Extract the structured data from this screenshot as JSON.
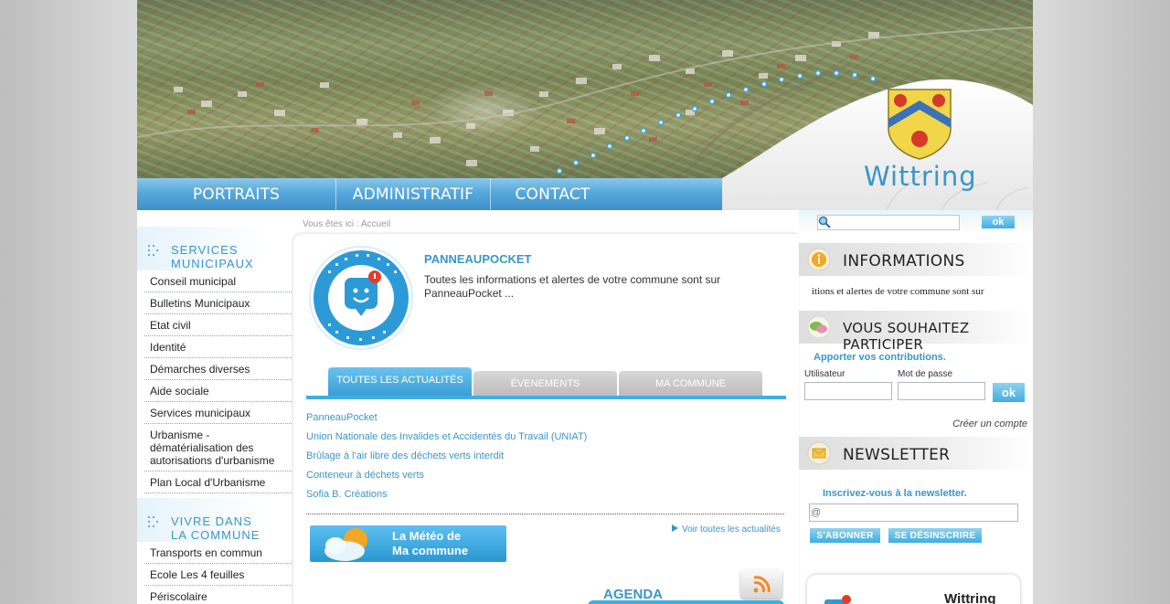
{
  "header": {
    "town_name": "Wittring",
    "nav": [
      "PORTRAITS",
      "ADMINISTRATIF",
      "CONTACT"
    ]
  },
  "breadcrumb": "Vous êtes ici : Accueil",
  "search": {
    "placeholder": "",
    "button": "ok"
  },
  "left": {
    "sections": [
      {
        "title": "SERVICES\nMUNICIPAUX",
        "items": [
          "Conseil municipal",
          "Bulletins Municipaux",
          "Etat civil",
          "Identité",
          "Démarches diverses",
          "Aide sociale",
          "Services municipaux",
          "Urbanisme - dématérialisation des autorisations d'urbanisme",
          "Plan Local d'Urbanisme"
        ]
      },
      {
        "title": "VIVRE DANS\nLA COMMUNE",
        "items": [
          "Transports en commun",
          "Ecole Les 4 feuilles",
          "Périscolaire"
        ]
      }
    ]
  },
  "main": {
    "pp_title": "PANNEAUPOCKET",
    "pp_text": "Toutes les informations et alertes de votre commune sont sur PanneauPocket ...",
    "tabs": [
      "TOUTES LES ACTUALITÉS",
      "ÉVENEMENTS",
      "MA COMMUNE"
    ],
    "news": [
      "PanneauPocket",
      "Union Nationale des Invalides et Accidentés du Travail (UNIAT)",
      "Brûlage à l'air libre des déchets verts interdit",
      "Conteneur à déchets verts",
      "Sofia B. Créations"
    ],
    "meteo": "La Météo de\nMa commune",
    "all_news": "Voir toutes les actualités",
    "agenda": "AGENDA"
  },
  "right": {
    "informations_title": "INFORMATIONS",
    "informations_marquee": "itions et alertes de votre commune sont sur",
    "participer_title": "VOUS SOUHAITEZ PARTICIPER",
    "participer_text": "Apporter vos contributions.",
    "username_label": "Utilisateur",
    "password_label": "Mot de passe",
    "login_button": "ok",
    "create_account": "Créer un compte",
    "newsletter_title": "NEWSLETTER",
    "newsletter_text": "Inscrivez-vous à la newsletter.",
    "newsletter_placeholder": "@",
    "subscribe": "S'ABONNER",
    "unsubscribe": "SE DÉSINSCRIRE",
    "app_card_name": "Wittring"
  },
  "colors": {
    "accent": "#3a96c7",
    "button": "#41aee0",
    "background": "#d9d9d9"
  },
  "icons": [
    "search-icon",
    "dots-icon",
    "info-icon",
    "chat-icon",
    "envelope-icon",
    "rss-icon",
    "sun-cloud-icon",
    "panneaupocket-logo",
    "coat-of-arms"
  ]
}
